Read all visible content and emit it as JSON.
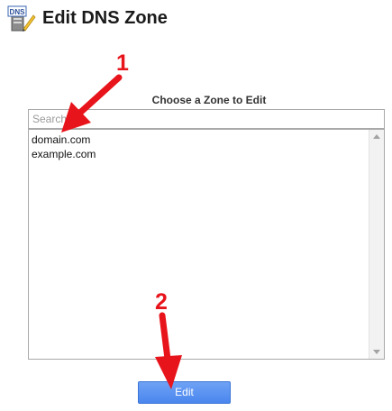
{
  "header": {
    "title": "Edit DNS Zone",
    "icon": "dns-icon",
    "icon_label": "DNS"
  },
  "zone_picker": {
    "label": "Choose a Zone to Edit",
    "search_placeholder": "Search",
    "items": [
      "domain.com",
      "example.com"
    ]
  },
  "actions": {
    "edit_label": "Edit"
  },
  "annotations": {
    "step1": "1",
    "step2": "2",
    "color": "#e8141b"
  },
  "colors": {
    "button": "#4a86ee",
    "annotation": "#e8141b"
  }
}
